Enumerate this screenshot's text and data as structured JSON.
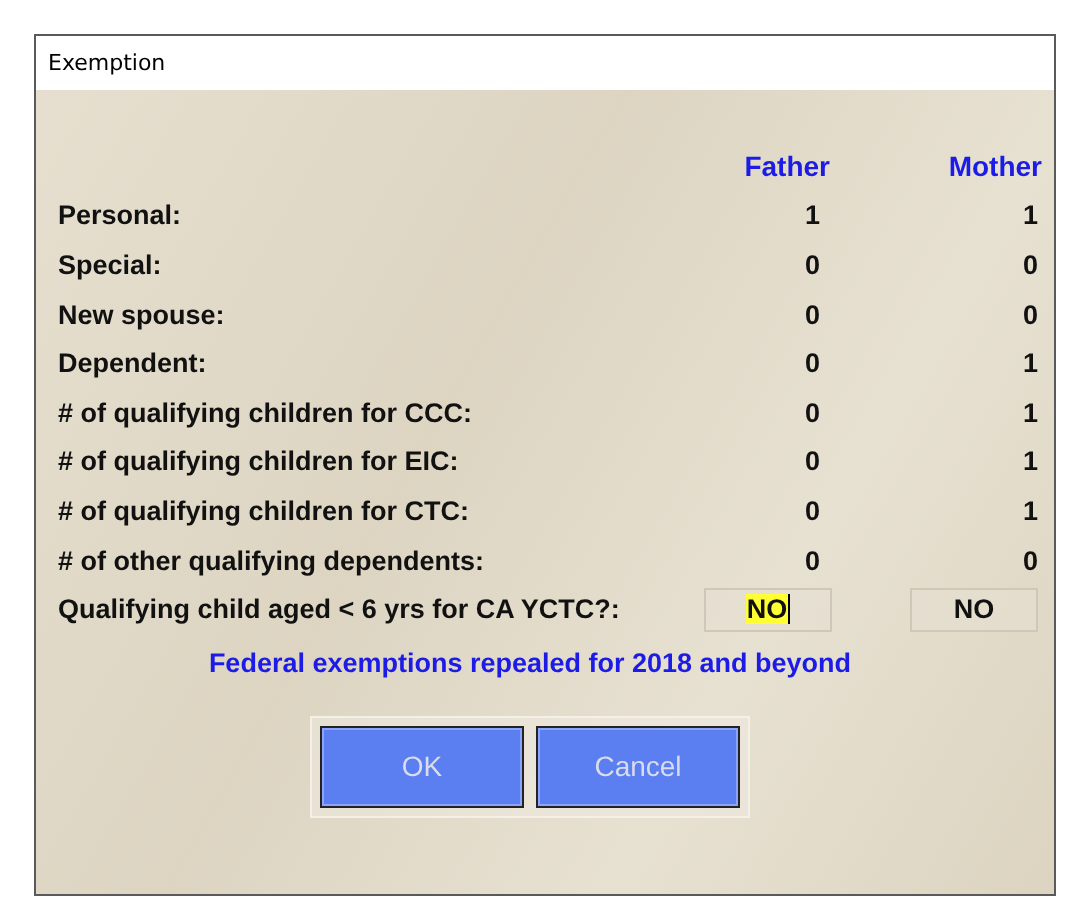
{
  "window": {
    "title": "Exemption"
  },
  "columns": [
    "Father",
    "Mother"
  ],
  "rows": [
    {
      "label": "Personal:",
      "values": [
        "1",
        "1"
      ]
    },
    {
      "label": "Special:",
      "values": [
        "0",
        "0"
      ]
    },
    {
      "label": "New spouse:",
      "values": [
        "0",
        "0"
      ]
    },
    {
      "label": "Dependent:",
      "values": [
        "0",
        "1"
      ]
    },
    {
      "label": "# of qualifying children for CCC:",
      "values": [
        "0",
        "1"
      ]
    },
    {
      "label": "# of qualifying children for EIC:",
      "values": [
        "0",
        "1"
      ]
    },
    {
      "label": "# of qualifying children for CTC:",
      "values": [
        "0",
        "1"
      ]
    },
    {
      "label": "# of other qualifying dependents:",
      "values": [
        "0",
        "0"
      ]
    }
  ],
  "question": {
    "label": "Qualifying child aged < 6 yrs for CA YCTC?:",
    "fields": [
      {
        "value": "NO",
        "focused": true
      },
      {
        "value": "NO",
        "focused": false
      }
    ]
  },
  "note": "Federal exemptions repealed for 2018 and beyond",
  "buttons": [
    "OK",
    "Cancel"
  ]
}
